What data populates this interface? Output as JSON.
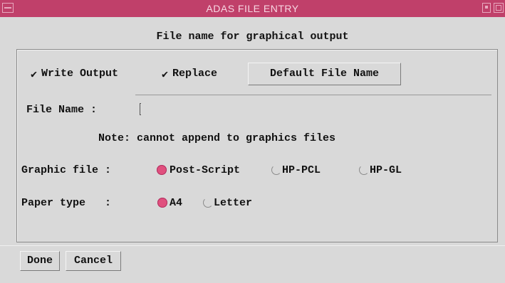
{
  "window": {
    "title": "ADAS FILE ENTRY"
  },
  "heading": "File name for graphical output",
  "options": {
    "write_output": {
      "label": "Write Output",
      "checked": true
    },
    "replace": {
      "label": "Replace",
      "checked": true
    },
    "default_button": "Default File Name"
  },
  "file_name": {
    "label": "File Name :",
    "value": ""
  },
  "note": "Note: cannot append to graphics files",
  "graphic_file": {
    "label": "Graphic file :",
    "options": [
      "Post-Script",
      "HP-PCL",
      "HP-GL"
    ],
    "selected": "Post-Script"
  },
  "paper_type": {
    "label": "Paper type   :",
    "options": [
      "A4",
      "Letter"
    ],
    "selected": "A4"
  },
  "buttons": {
    "done": "Done",
    "cancel": "Cancel"
  },
  "colors": {
    "titlebar": "#c0406a",
    "radio_on": "#e0507e",
    "background": "#d9d9d9"
  }
}
